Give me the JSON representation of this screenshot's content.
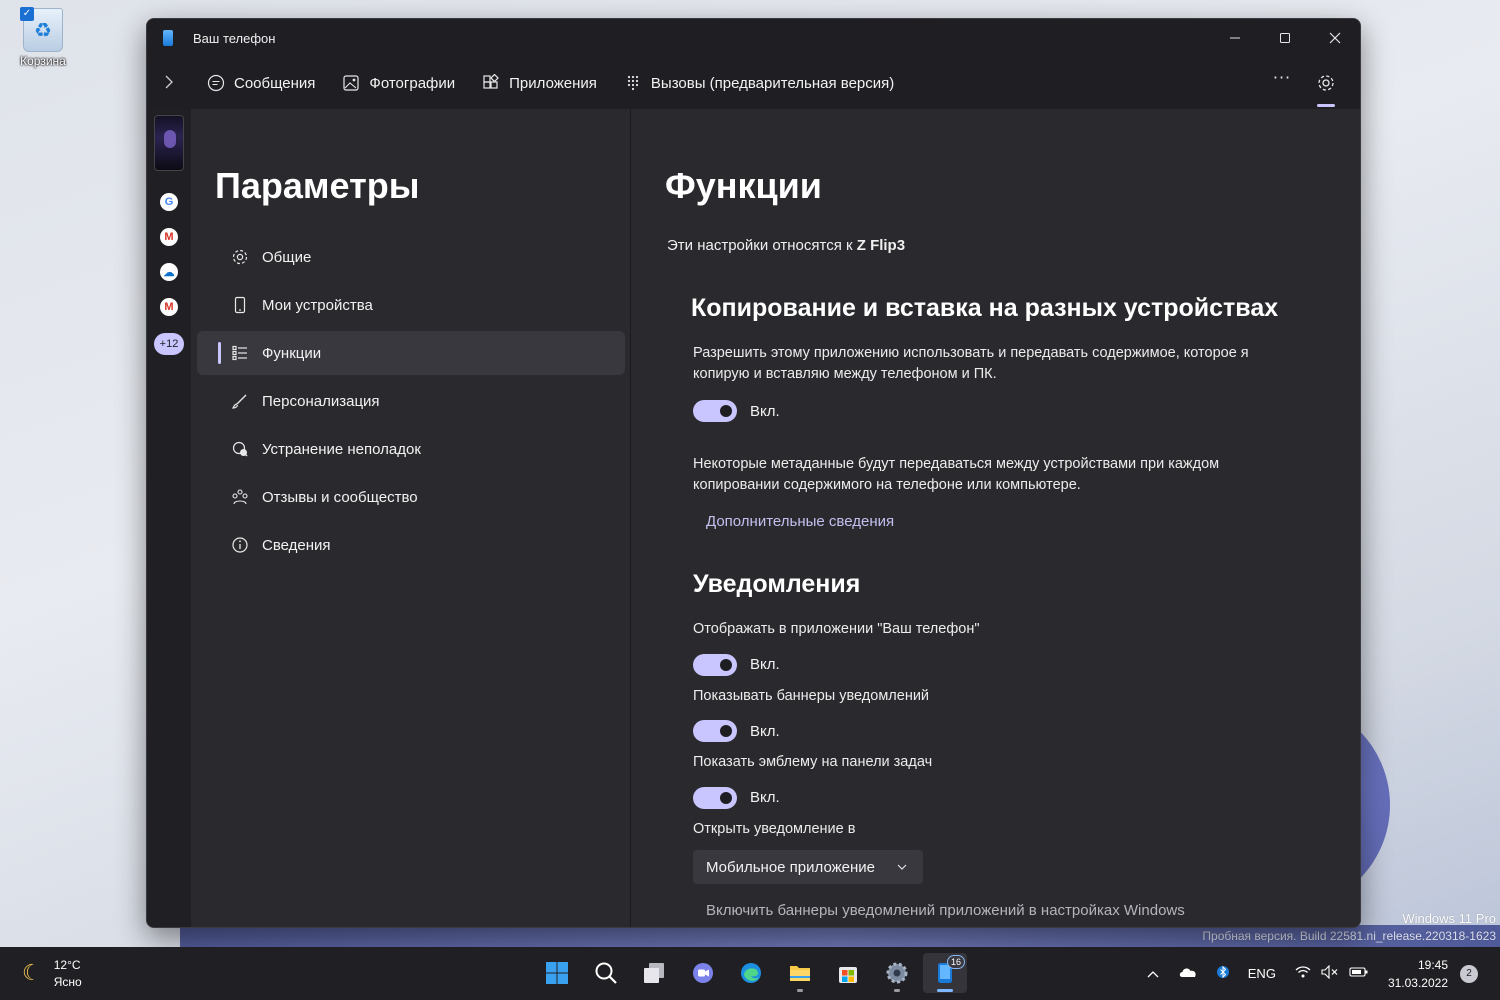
{
  "desktop": {
    "recycle_bin_label": "Корзина",
    "watermark_line1": "Windows 11 Pro",
    "watermark_line2": "Пробная версия. Build 22581.ni_release.220318-1623"
  },
  "window": {
    "title": "Ваш телефон",
    "controls": {
      "minimize": "—",
      "maximize": "☐",
      "close": "✕"
    }
  },
  "nav": {
    "tabs": [
      {
        "label": "Сообщения",
        "icon": "message-icon"
      },
      {
        "label": "Фотографии",
        "icon": "photo-icon"
      },
      {
        "label": "Приложения",
        "icon": "apps-icon"
      },
      {
        "label": "Вызовы (предварительная версия)",
        "icon": "dialpad-icon"
      }
    ],
    "more": "···"
  },
  "rail": {
    "apps": [
      {
        "icon": "google-icon",
        "glyph": "G",
        "color": "#4285f4"
      },
      {
        "icon": "gmail-icon",
        "glyph": "M",
        "color": "#d93025"
      },
      {
        "icon": "onedrive-icon",
        "glyph": "☁",
        "color": "#0a6fc9"
      },
      {
        "icon": "gmail-icon",
        "glyph": "M",
        "color": "#d93025"
      }
    ],
    "more": "+12"
  },
  "settings": {
    "title": "Параметры",
    "items": [
      {
        "label": "Общие",
        "icon": "gear-icon"
      },
      {
        "label": "Мои устройства",
        "icon": "phone-icon"
      },
      {
        "label": "Функции",
        "icon": "list-icon",
        "active": true
      },
      {
        "label": "Персонализация",
        "icon": "brush-icon"
      },
      {
        "label": "Устранение неполадок",
        "icon": "troubleshoot-icon"
      },
      {
        "label": "Отзывы и сообщество",
        "icon": "community-icon"
      },
      {
        "label": "Сведения",
        "icon": "info-icon"
      }
    ]
  },
  "content": {
    "title": "Функции",
    "applies_prefix": "Эти настройки относятся к ",
    "device_name": "Z Flip3",
    "copy_paste": {
      "title": "Копирование и вставка на разных устройствах",
      "description": "Разрешить этому приложению использовать и передавать содержимое, которое я копирую и вставляю между телефоном и ПК.",
      "toggle_label": "Вкл.",
      "metadata_note": "Некоторые метаданные будут передаваться между устройствами при каждом копировании содержимого на телефоне или компьютере.",
      "more_info_link": "Дополнительные сведения"
    },
    "notifications": {
      "title": "Уведомления",
      "show_in_app_label": "Отображать в приложении \"Ваш телефон\"",
      "show_in_app_toggle": "Вкл.",
      "banners_label": "Показывать баннеры уведомлений",
      "banners_toggle": "Вкл.",
      "badge_label": "Показать эмблему на панели задач",
      "badge_toggle": "Вкл.",
      "open_in_label": "Открыть уведомление в",
      "open_in_value": "Мобильное приложение",
      "windows_banners_link": "Включить баннеры уведомлений приложений в настройках Windows"
    }
  },
  "taskbar": {
    "weather_temp": "12°C",
    "weather_cond": "Ясно",
    "phone_badge": "16",
    "language": "ENG",
    "time": "19:45",
    "date": "31.03.2022",
    "notification_count": "2"
  }
}
